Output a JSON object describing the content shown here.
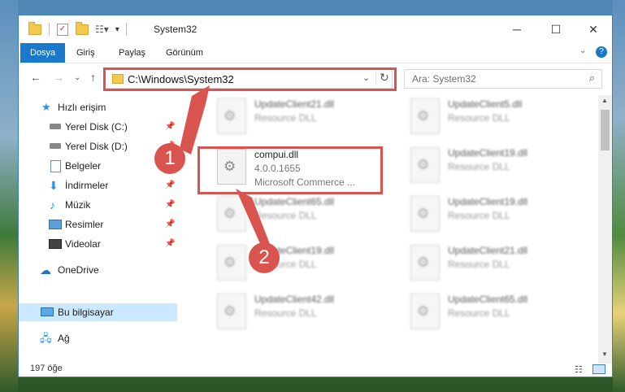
{
  "window": {
    "title": "System32"
  },
  "ribbon": {
    "tabs": [
      "Dosya",
      "Giriş",
      "Paylaş",
      "Görünüm"
    ]
  },
  "address": {
    "path": "C:\\Windows\\System32",
    "search_placeholder": "Ara: System32"
  },
  "sidebar": {
    "items": [
      {
        "label": "Hızlı erişim",
        "icon": "star-icon",
        "pinned": false
      },
      {
        "label": "Yerel Disk (C:)",
        "icon": "drive-icon",
        "pinned": true
      },
      {
        "label": "Yerel Disk (D:)",
        "icon": "drive-icon",
        "pinned": true
      },
      {
        "label": "Belgeler",
        "icon": "documents-icon",
        "pinned": true
      },
      {
        "label": "İndirmeler",
        "icon": "download-icon",
        "pinned": true
      },
      {
        "label": "Müzik",
        "icon": "music-icon",
        "pinned": true
      },
      {
        "label": "Resimler",
        "icon": "pictures-icon",
        "pinned": true
      },
      {
        "label": "Videolar",
        "icon": "video-icon",
        "pinned": true
      },
      {
        "label": "OneDrive",
        "icon": "cloud-icon",
        "pinned": false
      },
      {
        "label": "Bu bilgisayar",
        "icon": "computer-icon",
        "pinned": false,
        "selected": true
      },
      {
        "label": "Ağ",
        "icon": "network-icon",
        "pinned": false
      }
    ]
  },
  "files": [
    {
      "name": "UpdateClient21.dll",
      "sub": "Resource DLL"
    },
    {
      "name": "UpdateClient5.dll",
      "sub": "Resource DLL"
    },
    {
      "name": "compui.dll",
      "sub": "4.0.0.1655",
      "sub2": "Microsoft Commerce ...",
      "highlighted": true
    },
    {
      "name": "UpdateClient19.dll",
      "sub": "Resource DLL"
    },
    {
      "name": "UpdateClient65.dll",
      "sub": "Resource DLL"
    },
    {
      "name": "UpdateClient19.dll",
      "sub": "Resource DLL"
    },
    {
      "name": "UpdateClient19.dll",
      "sub": "Resource DLL"
    },
    {
      "name": "UpdateClient21.dll",
      "sub": "Resource DLL"
    },
    {
      "name": "UpdateClient42.dll",
      "sub": "Resource DLL"
    },
    {
      "name": "UpdateClient65.dll",
      "sub": "Resource DLL"
    }
  ],
  "status": {
    "count": "197 öğe"
  },
  "annotations": {
    "badge1": "1",
    "badge2": "2"
  },
  "colors": {
    "accent": "#1979ca",
    "highlight": "#d9534f",
    "selected": "#cce8ff"
  }
}
